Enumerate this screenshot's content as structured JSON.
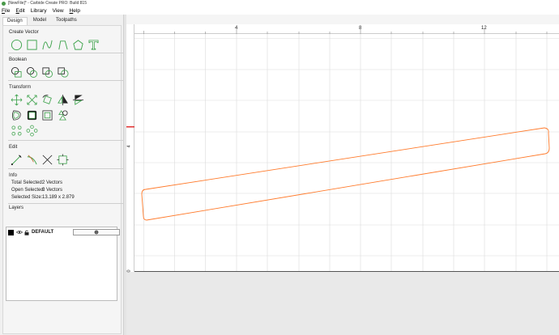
{
  "window": {
    "title": "[NewFile]* - Carbide Create PRO: Build 815"
  },
  "menu": [
    {
      "u": "F",
      "rest": "ile"
    },
    {
      "u": "E",
      "rest": "dit"
    },
    {
      "u": "",
      "rest": "Library"
    },
    {
      "u": "",
      "rest": "View"
    },
    {
      "u": "H",
      "rest": "elp"
    }
  ],
  "tabs": [
    "Design",
    "Model",
    "Toolpaths"
  ],
  "sections": {
    "create_vector": "Create Vector",
    "boolean": "Boolean",
    "transform": "Transform",
    "edit": "Edit",
    "info": "Info",
    "layers": "Layers"
  },
  "icons": {
    "create_vector": [
      "circle-icon",
      "rectangle-icon",
      "curve-icon",
      "polyline-icon",
      "polygon-icon",
      "text-icon"
    ],
    "boolean": [
      "union-icon",
      "subtract-icon",
      "intersect-icon",
      "weld-icon"
    ],
    "transform_row1": [
      "move-icon",
      "scale-icon",
      "rotate-icon",
      "mirror-horizontal-icon",
      "mirror-vertical-icon"
    ],
    "transform_row2": [
      "offset-icon",
      "inset-icon",
      "boundary-icon",
      "align-icon"
    ],
    "transform_row3": [
      "array-icon",
      "circular-array-icon"
    ],
    "edit": [
      "node-edit-icon",
      "trim-icon",
      "cut-icon",
      "join-icon"
    ]
  },
  "info": {
    "total_selected_label": "Total Selected:",
    "total_selected_value": "2 Vectors",
    "open_selected_label": "Open Selected:",
    "open_selected_value": "0 Vectors",
    "selected_size_label": "Selected Size:",
    "selected_size_value": "13.189 x 2.879"
  },
  "layers": [
    {
      "name": "DEFAULT",
      "color": "#000000"
    }
  ],
  "colors": {
    "accent": "#3fa34d",
    "selection": "#ff7a2b",
    "origin_marker": "#e03030"
  },
  "ruler": {
    "x_ticks": [
      "4",
      "8",
      "12"
    ],
    "y_ticks": [
      "4",
      "0"
    ]
  }
}
